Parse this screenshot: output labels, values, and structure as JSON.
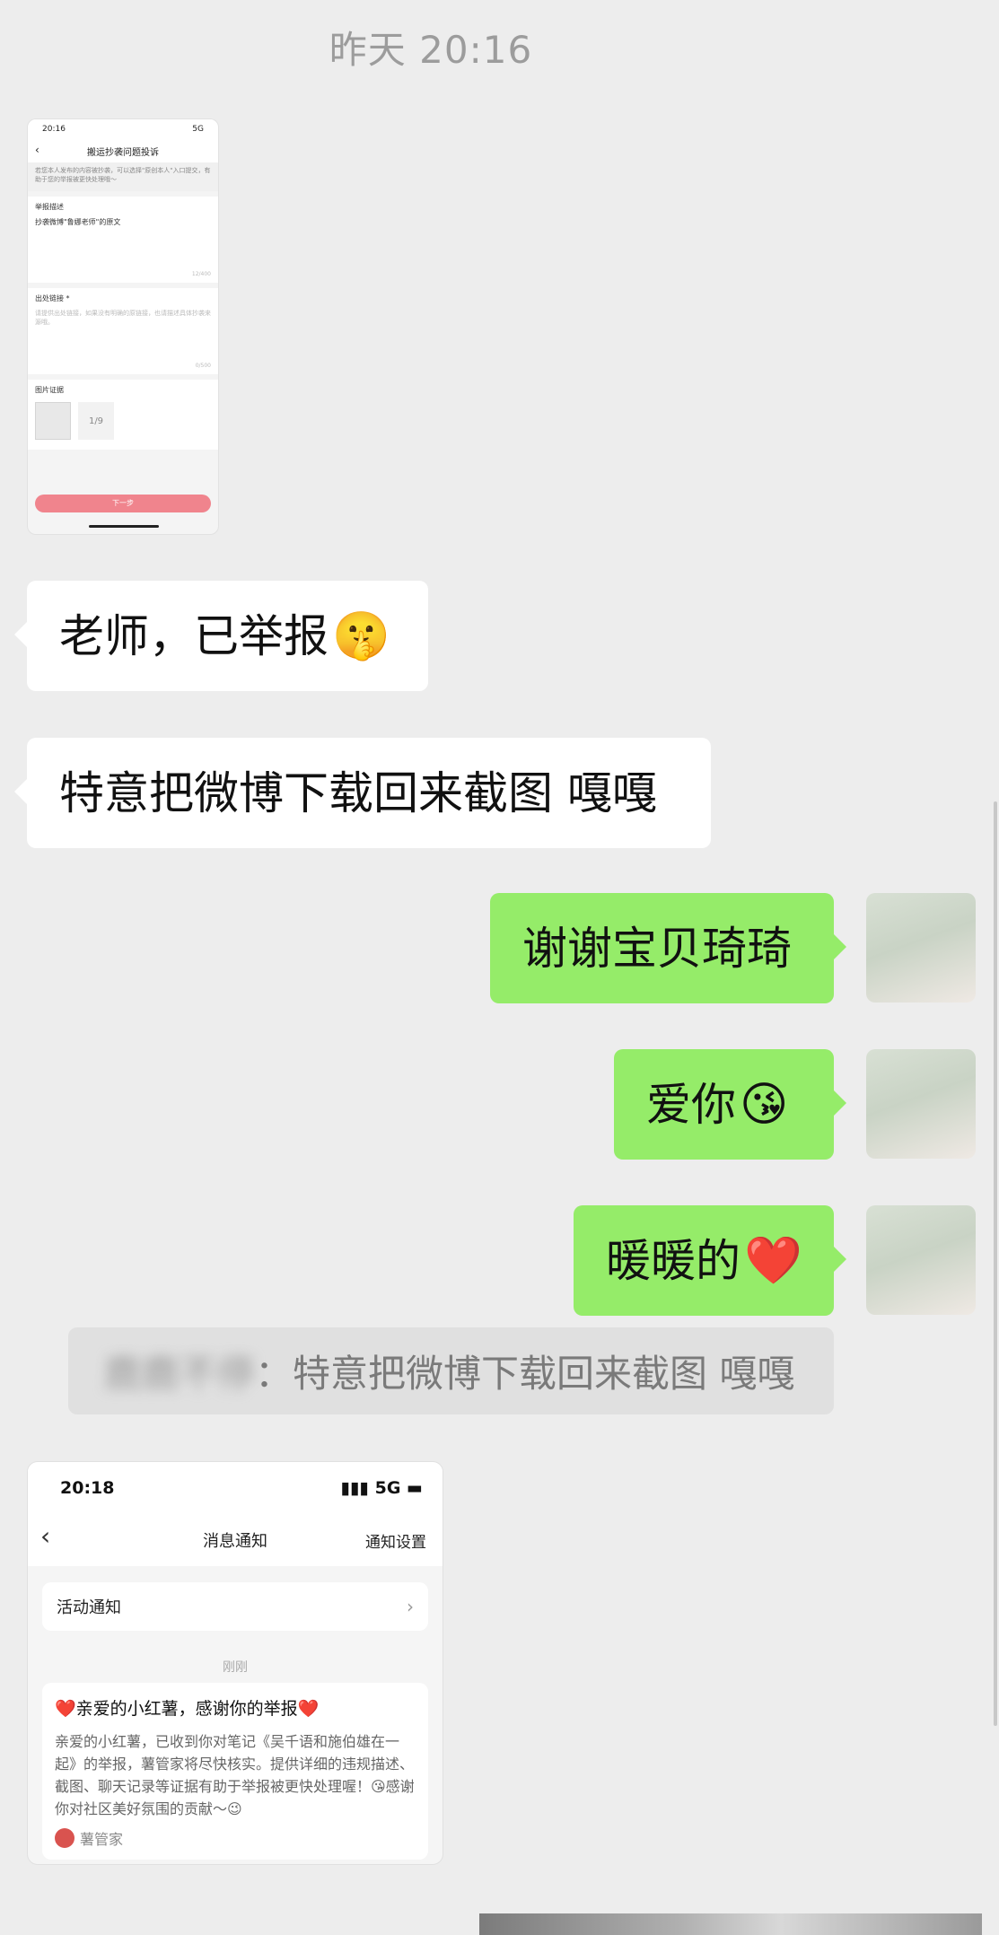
{
  "timestamp": "昨天 20:16",
  "screenshot1": {
    "time": "20:16",
    "network": "5G",
    "title": "搬运抄袭问题投诉",
    "notice": "若您本人发布的内容被抄袭，可以选择\"原创本人\"入口提交，有助于您的举报被更快处理哦～",
    "desc_label": "举报描述",
    "desc_value": "抄袭微博\"鲁娜老师\"的原文",
    "desc_count": "12/400",
    "link_label": "出处链接 *",
    "link_placeholder": "请提供出处链接，如果没有明确的原链接，也请描述具体抄袭来源哦。",
    "link_count": "0/500",
    "images_label": "图片证据",
    "add_count": "1/9",
    "next_button": "下一步"
  },
  "messages": [
    {
      "side": "left",
      "text": "老师，已举报",
      "emoji": "🤫"
    },
    {
      "side": "left",
      "text": "特意把微博下载回来截图 嘎嘎",
      "emoji": ""
    },
    {
      "side": "right",
      "text": "谢谢宝贝琦琦",
      "emoji": ""
    },
    {
      "side": "right",
      "text": "爱你",
      "emoji": "😘"
    },
    {
      "side": "right",
      "text": "暖暖的",
      "emoji": "❤️"
    }
  ],
  "quote": {
    "sender": "鹿鹿不停",
    "text": "：特意把微博下载回来截图 嘎嘎"
  },
  "screenshot2": {
    "time": "20:18",
    "network": "5G",
    "title": "消息通知",
    "settings": "通知设置",
    "activity": "活动通知",
    "time_label": "刚刚",
    "msg_title": "❤️亲爱的小红薯，感谢你的举报❤️",
    "msg_body": "亲爱的小红薯，已收到你对笔记《吴千语和施伯雄在一起》的举报，薯管家将尽快核实。提供详细的违规描述、截图、聊天记录等证据有助于举报被更快处理喔！😘感谢你对社区美好氛围的贡献～😉",
    "sender": "薯管家"
  },
  "colors": {
    "background": "#ededed",
    "bubble_left": "#ffffff",
    "bubble_right": "#95ec69"
  }
}
